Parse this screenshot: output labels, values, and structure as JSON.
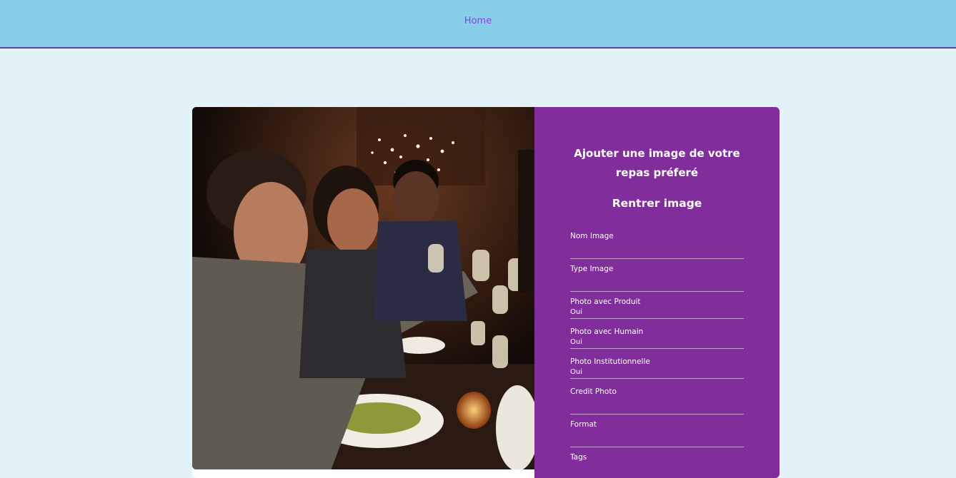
{
  "nav": {
    "home_label": "Home"
  },
  "form": {
    "title": "Ajouter une image de votre repas préferé",
    "subtitle": "Rentrer image",
    "fields": [
      {
        "label": "Nom Image",
        "value": ""
      },
      {
        "label": "Type Image",
        "value": ""
      },
      {
        "label": "Photo avec Produit",
        "value": "Oui"
      },
      {
        "label": "Photo avec Humain",
        "value": "Oui"
      },
      {
        "label": "Photo Institutionnelle",
        "value": "Oui"
      },
      {
        "label": "Credit Photo",
        "value": ""
      },
      {
        "label": "Format",
        "value": ""
      },
      {
        "label": "Tags",
        "value": ""
      }
    ]
  },
  "colors": {
    "header_bg": "#87ceeb",
    "header_border": "#6a3aa6",
    "nav_link": "#8a3fe0",
    "page_bg": "#e2f2f8",
    "form_bg": "#812d9c"
  }
}
